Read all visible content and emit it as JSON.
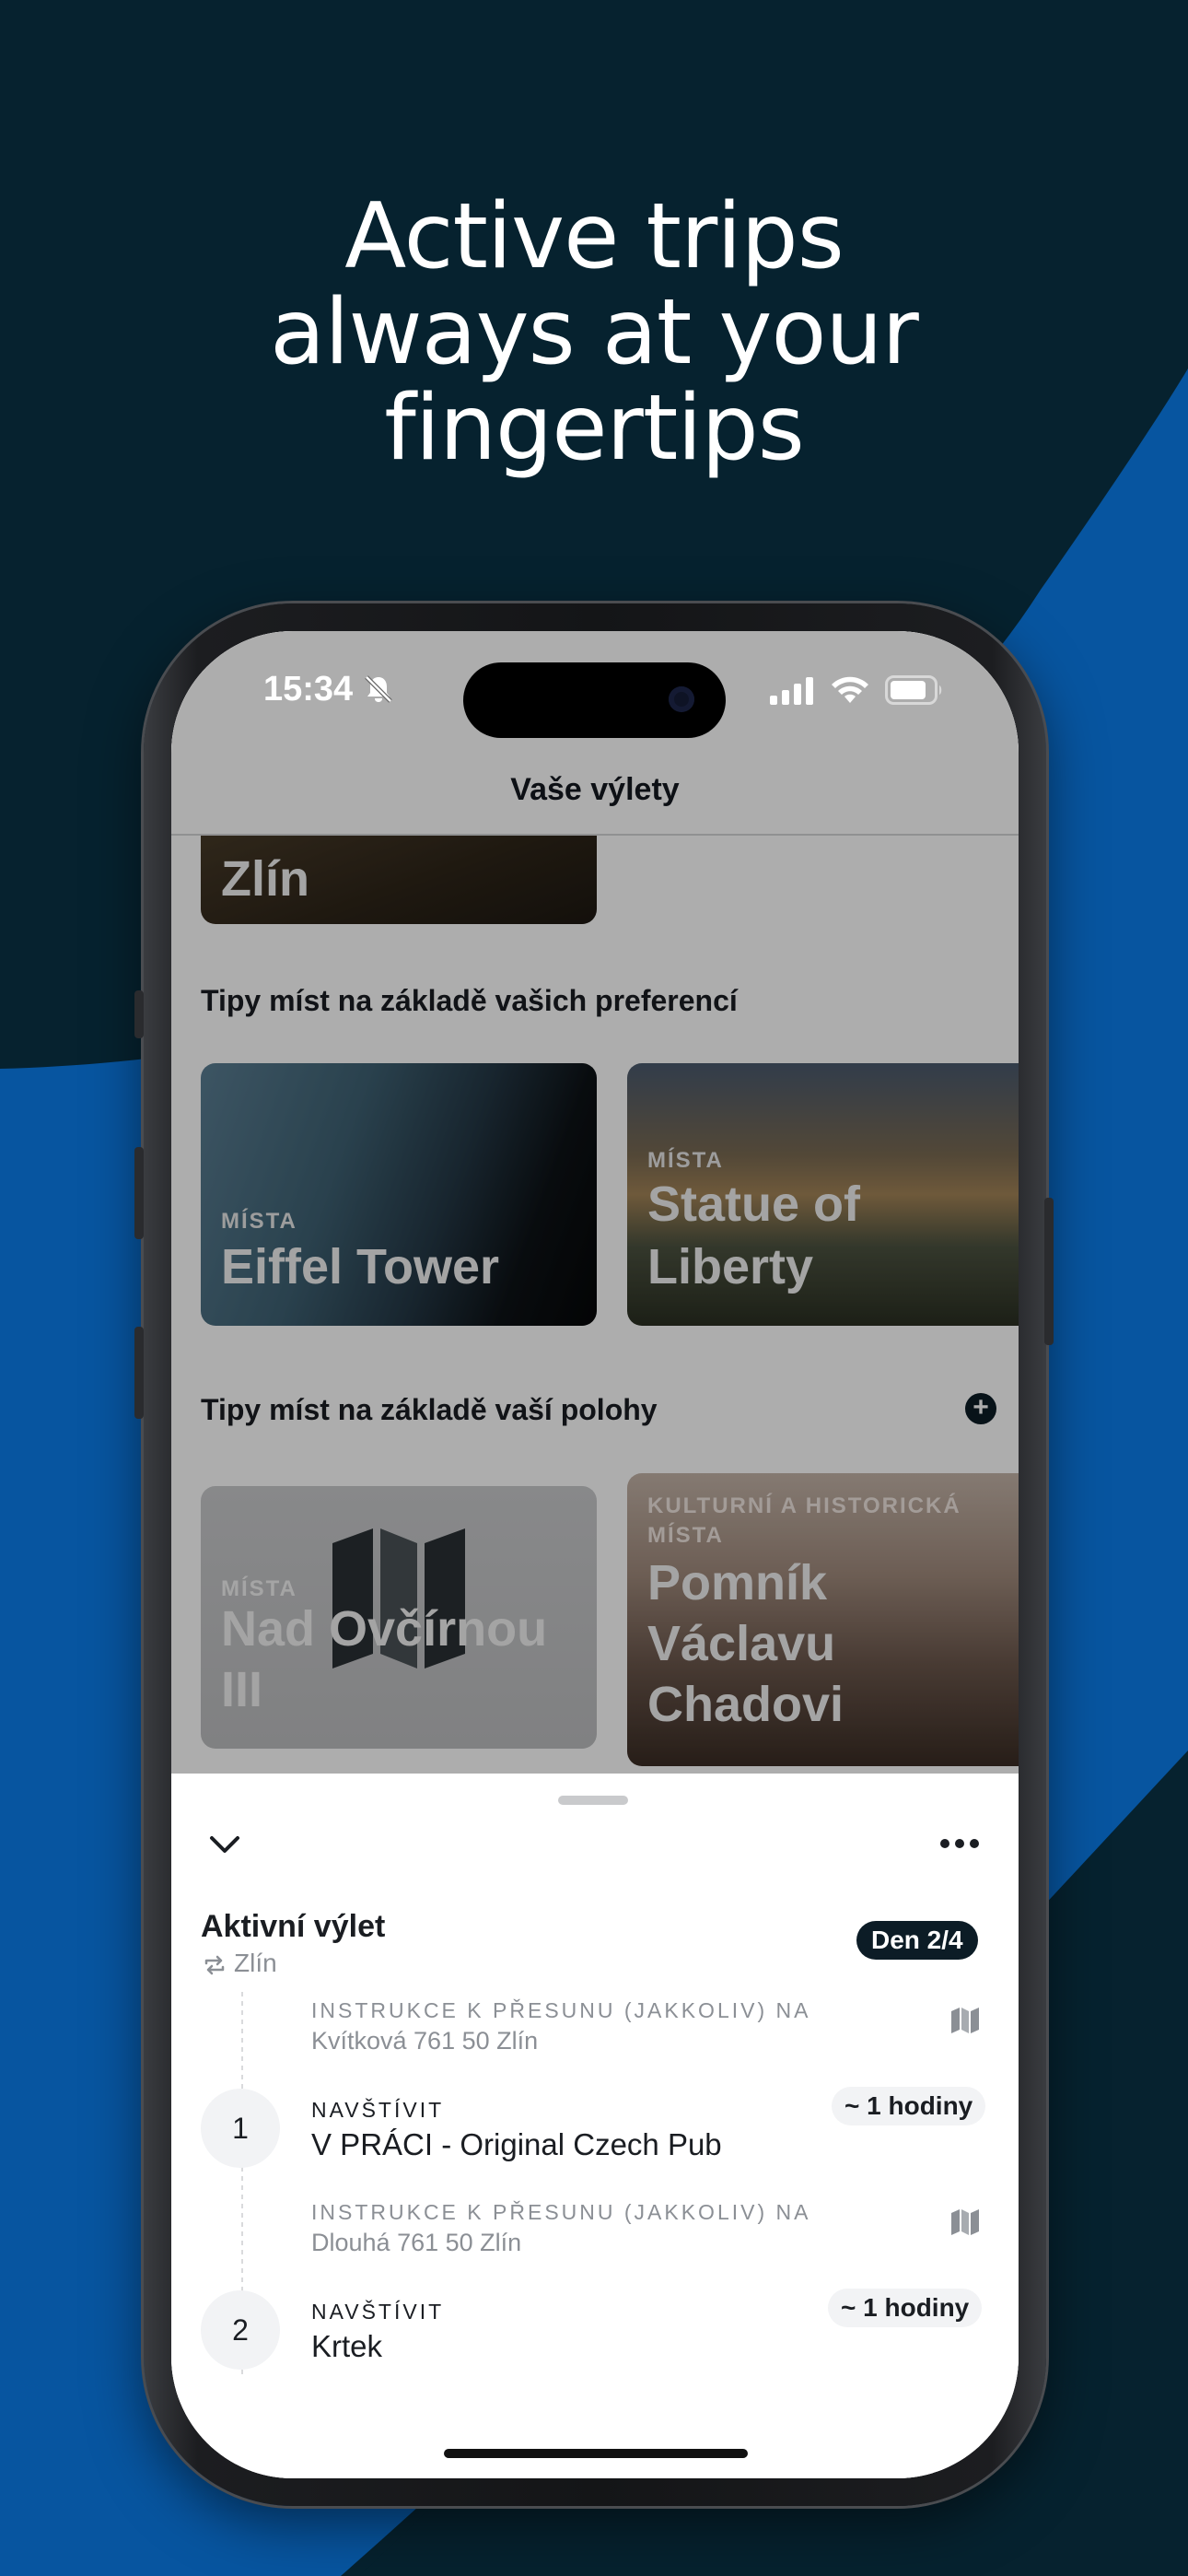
{
  "headline": {
    "line1": "Active trips",
    "line2": "always at your",
    "line3": "fingertips"
  },
  "colors": {
    "background_dark": "#06222f",
    "background_blue": "#0755a0",
    "accent": "#0c1c26"
  },
  "status_bar": {
    "time": "15:34",
    "silent_icon": "bell-slash-icon",
    "signal_icon": "cellular-signal-icon",
    "wifi_icon": "wifi-icon",
    "battery_icon": "battery-icon"
  },
  "nav": {
    "title": "Vaše výlety"
  },
  "trip_card": {
    "title": "Zlín"
  },
  "sections": {
    "preferences_title": "Tipy míst na základě vašich preferencí",
    "location_title": "Tipy míst na základě vaší polohy",
    "add_icon": "plus-circle-icon"
  },
  "preference_cards": [
    {
      "category": "MÍSTA",
      "title": "Eiffel Tower"
    },
    {
      "category": "MÍSTA",
      "title_line1": "Statue of",
      "title_line2": "Liberty"
    }
  ],
  "location_cards": [
    {
      "category": "MÍSTA",
      "title_line1": "Nad Ovčírnou",
      "title_line2": "III",
      "icon": "map-placeholder-icon"
    },
    {
      "category_line1": "KULTURNÍ A HISTORICKÁ",
      "category_line2": "MÍSTA",
      "title_line1": "Pomník",
      "title_line2": "Václavu",
      "title_line3": "Chadovi"
    }
  ],
  "sheet": {
    "collapse_icon": "chevron-down-icon",
    "more_icon": "more-horizontal-icon",
    "title": "Aktivní výlet",
    "city": "Zlín",
    "day_badge": "Den 2/4",
    "items": [
      {
        "type": "instruction",
        "caption": "INSTRUKCE K PŘESUNU (JAKKOLIV) NA",
        "address": "Kvítková 761 50 Zlín",
        "icon": "map-icon"
      },
      {
        "type": "visit",
        "number": "1",
        "caption": "NAVŠTÍVIT",
        "name": "V PRÁCI - Original Czech Pub",
        "duration": "~ 1 hodiny"
      },
      {
        "type": "instruction",
        "caption": "INSTRUKCE K PŘESUNU (JAKKOLIV) NA",
        "address": "Dlouhá 761 50 Zlín",
        "icon": "map-icon"
      },
      {
        "type": "visit",
        "number": "2",
        "caption": "NAVŠTÍVIT",
        "name": "Krtek",
        "duration": "~ 1 hodiny"
      }
    ]
  }
}
